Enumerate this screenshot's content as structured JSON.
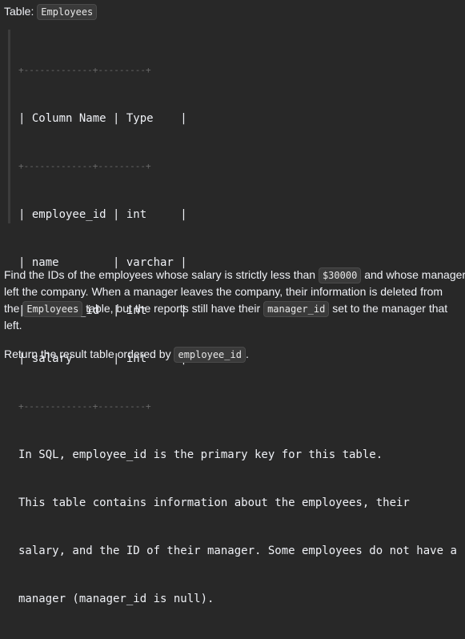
{
  "title_row": {
    "label": "Table:",
    "table_name": "Employees"
  },
  "schema": {
    "border_top": "+-------------+---------+",
    "header": "| Column Name | Type    |",
    "border_mid": "+-------------+---------+",
    "rows": [
      "| employee_id | int     |",
      "| name        | varchar |",
      "| manager_id  | int     |",
      "| salary      | int     |"
    ],
    "border_bottom": "+-------------+---------+",
    "notes": [
      "In SQL, employee_id is the primary key for this table.",
      "This table contains information about the employees, their",
      "salary, and the ID of their manager. Some employees do not have a",
      "manager (manager_id is null)."
    ]
  },
  "description": {
    "p1_a": "Find the IDs of the employees whose salary is strictly less than ",
    "p1_code1": "$30000",
    "p1_b": " and whose manager",
    "p1_c": "left the company. When a manager leaves the company, their information is deleted from",
    "p1_d": "the ",
    "p1_code2": "Employees",
    "p1_e": " table, but the reports still have their ",
    "p1_code3": "manager_id",
    "p1_f": " set to the manager that",
    "p1_g": "left.",
    "p2_a": "Return the result table ordered by ",
    "p2_code": "employee_id",
    "p2_b": "."
  }
}
